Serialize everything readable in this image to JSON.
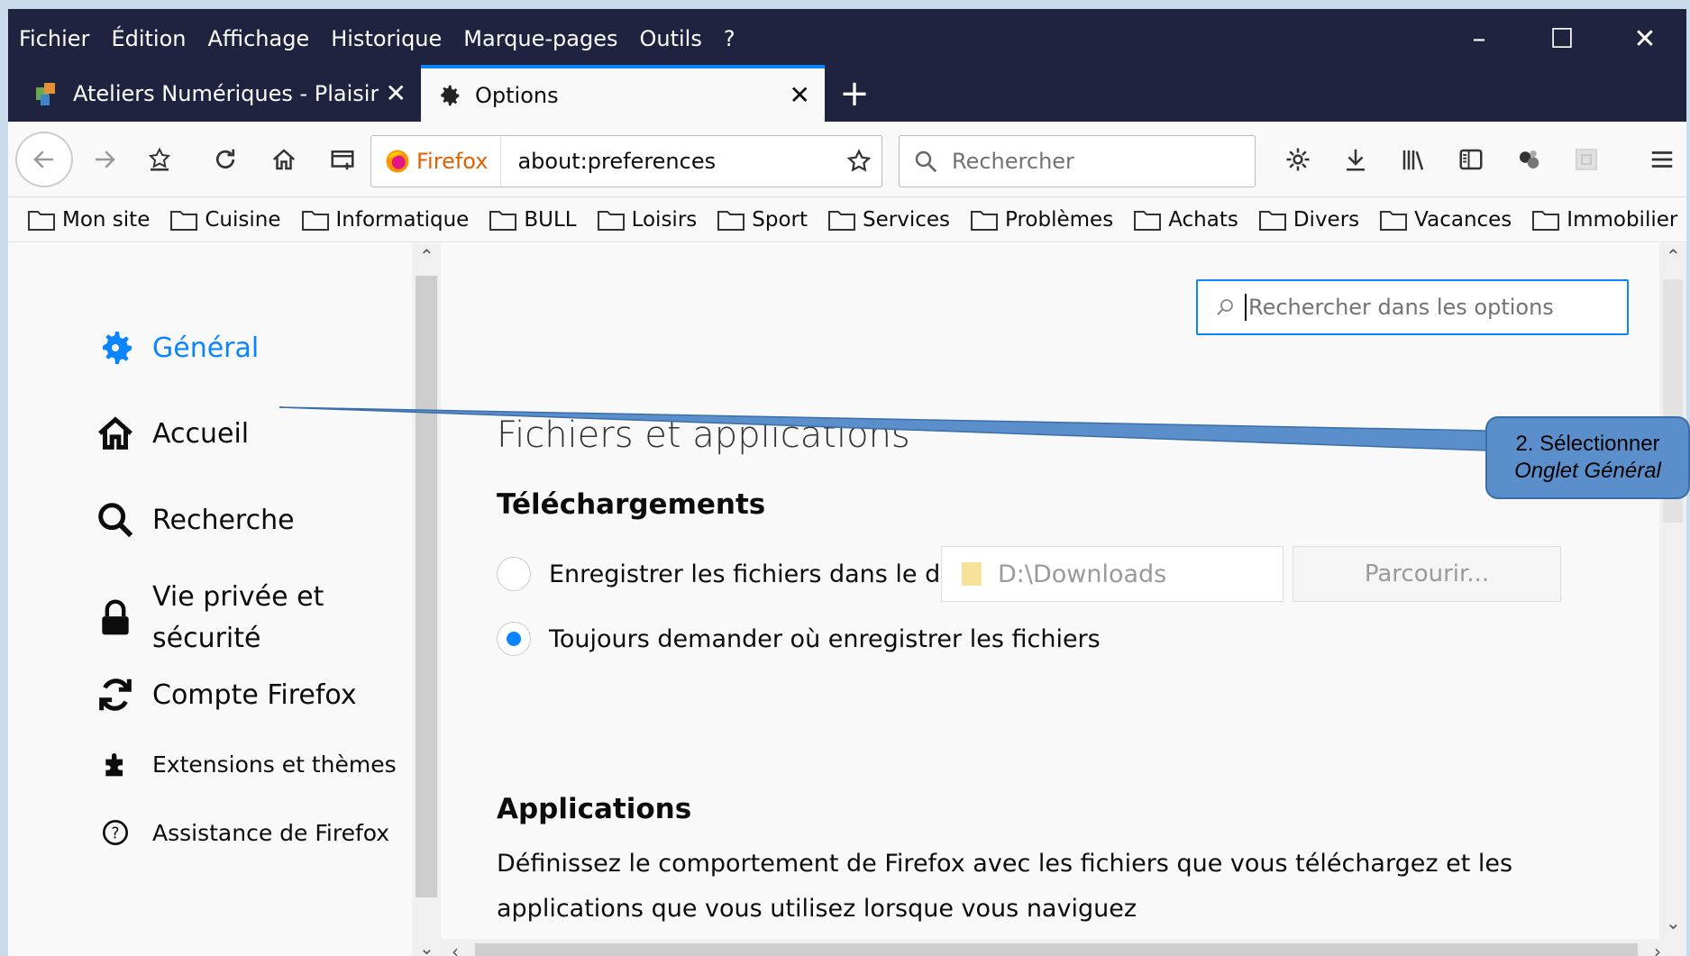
{
  "menubar": {
    "items": [
      "Fichier",
      "Édition",
      "Affichage",
      "Historique",
      "Marque-pages",
      "Outils",
      "?"
    ]
  },
  "window_controls": {
    "minimize": "–",
    "maximize": "☐",
    "close": "✕"
  },
  "tabs": [
    {
      "title": "Ateliers Numériques - Plaisir",
      "close": "✕"
    },
    {
      "title": "Options",
      "close": "✕"
    }
  ],
  "newtab": "+",
  "urlbar": {
    "identity": "Firefox",
    "url": "about:preferences"
  },
  "searchbar": {
    "placeholder": "Rechercher"
  },
  "bookmarks": [
    "Mon site",
    "Cuisine",
    "Informatique",
    "BULL",
    "Loisirs",
    "Sport",
    "Services",
    "Problèmes",
    "Achats",
    "Divers",
    "Vacances",
    "Immobilier"
  ],
  "bookmarks_overflow": "»",
  "sidebar": {
    "items": [
      {
        "label": "Général"
      },
      {
        "label": "Accueil"
      },
      {
        "label": "Recherche"
      },
      {
        "label": "Vie privée et",
        "label2": "sécurité"
      },
      {
        "label": "Compte Firefox"
      },
      {
        "label": "Extensions et thèmes"
      },
      {
        "label": "Assistance de Firefox"
      }
    ]
  },
  "main": {
    "search_placeholder": "Rechercher dans les options",
    "section_title": "Fichiers et applications",
    "downloads_heading": "Téléchargements",
    "radio_save": "Enregistrer les fichiers dans le dossier",
    "radio_ask": "Toujours demander où enregistrer les fichiers",
    "download_path": "D:\\Downloads",
    "browse_button": "Parcourir...",
    "applications_heading": "Applications",
    "applications_desc": "Définissez le comportement de Firefox avec les fichiers que vous téléchargez et les applications que vous utilisez lorsque vous naviguez"
  },
  "callout": {
    "line1": "2. Sélectionner",
    "line2": "Onglet Général"
  },
  "colors": {
    "accent": "#0a84ff",
    "titlebar": "#202340",
    "callout": "#5a8fcc"
  }
}
